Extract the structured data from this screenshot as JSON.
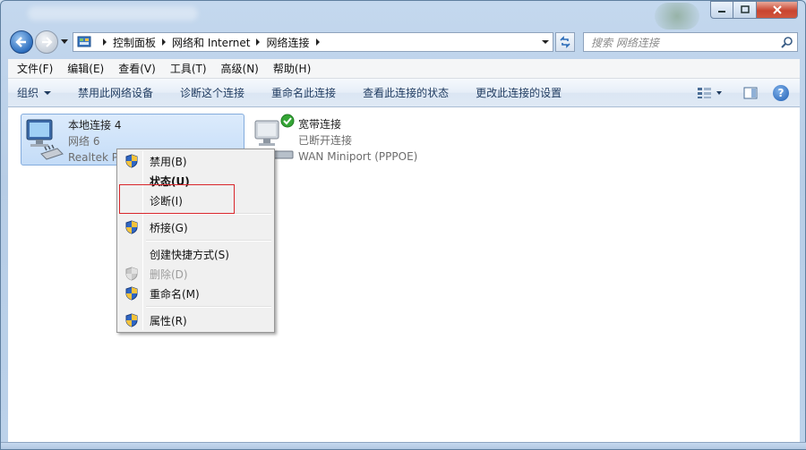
{
  "window": {
    "caption_controls": [
      "minimize",
      "maximize",
      "close"
    ]
  },
  "address_bar": {
    "crumbs": [
      "控制面板",
      "网络和 Internet",
      "网络连接"
    ]
  },
  "search": {
    "placeholder": "搜索 网络连接"
  },
  "menubar": {
    "items": [
      "文件(F)",
      "编辑(E)",
      "查看(V)",
      "工具(T)",
      "高级(N)",
      "帮助(H)"
    ]
  },
  "commandbar": {
    "organize": "组织",
    "items": [
      "禁用此网络设备",
      "诊断这个连接",
      "重命名此连接",
      "查看此连接的状态",
      "更改此连接的设置"
    ],
    "help": "?"
  },
  "connections": [
    {
      "name": "本地连接 4",
      "status": "网络  6",
      "device": "Realtek P",
      "selected": true
    },
    {
      "name": "宽带连接",
      "status": "已断开连接",
      "device": "WAN Miniport (PPPOE)",
      "selected": false
    }
  ],
  "context_menu": {
    "items": [
      {
        "label": "禁用(B)",
        "icon": "uac-shield-icon",
        "bold": false,
        "disabled": false
      },
      {
        "label": "状态(U)",
        "icon": "",
        "bold": true,
        "disabled": false
      },
      {
        "label": "诊断(I)",
        "icon": "",
        "bold": false,
        "disabled": false,
        "highlighted": true
      },
      {
        "label": "桥接(G)",
        "icon": "uac-shield-icon",
        "bold": false,
        "disabled": false
      },
      {
        "label": "创建快捷方式(S)",
        "icon": "",
        "bold": false,
        "disabled": false
      },
      {
        "label": "删除(D)",
        "icon": "uac-shield-icon",
        "bold": false,
        "disabled": true
      },
      {
        "label": "重命名(M)",
        "icon": "uac-shield-icon",
        "bold": false,
        "disabled": false
      },
      {
        "label": "属性(R)",
        "icon": "uac-shield-icon",
        "bold": false,
        "disabled": false
      }
    ],
    "highlight_color": "#d9262b"
  },
  "colors": {
    "selection_bg": "#c4dcf7",
    "command_text": "#1e3a5f",
    "close_button": "#c84530"
  }
}
